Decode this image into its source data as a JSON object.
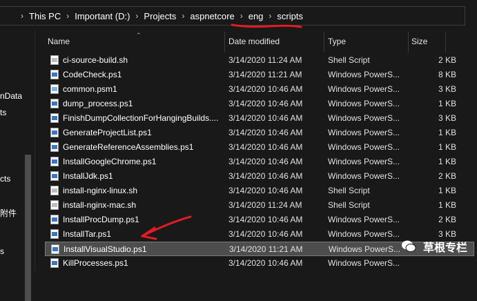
{
  "breadcrumb": [
    "This PC",
    "Important (D:)",
    "Projects",
    "aspnetcore",
    "eng",
    "scripts"
  ],
  "left_nav": [
    "nData",
    "ts",
    "cts",
    "附件",
    "s"
  ],
  "columns": {
    "name": "Name",
    "date": "Date modified",
    "type": "Type",
    "size": "Size"
  },
  "files": [
    {
      "name": "ci-source-build.sh",
      "date": "3/14/2020 11:24 AM",
      "type": "Shell Script",
      "size": "2 KB",
      "icon": "shell-script-icon"
    },
    {
      "name": "CodeCheck.ps1",
      "date": "3/14/2020 11:21 AM",
      "type": "Windows PowerS...",
      "size": "8 KB",
      "icon": "powershell-icon"
    },
    {
      "name": "common.psm1",
      "date": "3/14/2020 10:46 AM",
      "type": "Windows PowerS...",
      "size": "3 KB",
      "icon": "powershell-module-icon"
    },
    {
      "name": "dump_process.ps1",
      "date": "3/14/2020 10:46 AM",
      "type": "Windows PowerS...",
      "size": "1 KB",
      "icon": "powershell-icon"
    },
    {
      "name": "FinishDumpCollectionForHangingBuilds....",
      "date": "3/14/2020 10:46 AM",
      "type": "Windows PowerS...",
      "size": "3 KB",
      "icon": "powershell-icon"
    },
    {
      "name": "GenerateProjectList.ps1",
      "date": "3/14/2020 10:46 AM",
      "type": "Windows PowerS...",
      "size": "1 KB",
      "icon": "powershell-icon"
    },
    {
      "name": "GenerateReferenceAssemblies.ps1",
      "date": "3/14/2020 10:46 AM",
      "type": "Windows PowerS...",
      "size": "1 KB",
      "icon": "powershell-icon"
    },
    {
      "name": "InstallGoogleChrome.ps1",
      "date": "3/14/2020 10:46 AM",
      "type": "Windows PowerS...",
      "size": "1 KB",
      "icon": "powershell-icon"
    },
    {
      "name": "InstallJdk.ps1",
      "date": "3/14/2020 10:46 AM",
      "type": "Windows PowerS...",
      "size": "2 KB",
      "icon": "powershell-icon"
    },
    {
      "name": "install-nginx-linux.sh",
      "date": "3/14/2020 10:46 AM",
      "type": "Shell Script",
      "size": "1 KB",
      "icon": "shell-script-icon"
    },
    {
      "name": "install-nginx-mac.sh",
      "date": "3/14/2020 11:24 AM",
      "type": "Shell Script",
      "size": "1 KB",
      "icon": "shell-script-icon"
    },
    {
      "name": "InstallProcDump.ps1",
      "date": "3/14/2020 10:46 AM",
      "type": "Windows PowerS...",
      "size": "2 KB",
      "icon": "powershell-icon"
    },
    {
      "name": "InstallTar.ps1",
      "date": "3/14/2020 10:46 AM",
      "type": "Windows PowerS...",
      "size": "3 KB",
      "icon": "powershell-icon"
    },
    {
      "name": "InstallVisualStudio.ps1",
      "date": "3/14/2020 11:21 AM",
      "type": "Windows PowerS...",
      "size": "",
      "icon": "powershell-icon",
      "selected": true
    },
    {
      "name": "KillProcesses.ps1",
      "date": "3/14/2020 10:46 AM",
      "type": "Windows PowerS...",
      "size": "",
      "icon": "powershell-icon"
    }
  ],
  "watermark": "草根专栏",
  "colors": {
    "annotation": "#e01b24",
    "background": "#191919",
    "selection": "#4d4d4d"
  }
}
